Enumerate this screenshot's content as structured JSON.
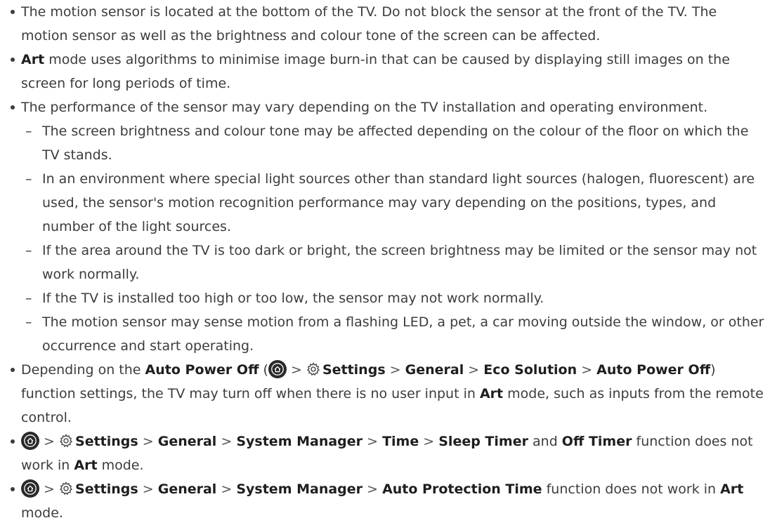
{
  "bullets": {
    "b1": "The motion sensor is located at the bottom of the TV. Do not block the sensor at the front of the TV. The motion sensor as well as the brightness and colour tone of the screen can be affected.",
    "b2": {
      "art": "Art",
      "text": " mode uses algorithms to minimise image burn-in that can be caused by displaying still images on the screen for long periods of time."
    },
    "b3": {
      "text": "The performance of the sensor may vary depending on the TV installation and operating environment.",
      "subs": [
        "The screen brightness and colour tone may be affected depending on the colour of the floor on which the TV stands.",
        "In an environment where special light sources other than standard light sources (halogen, fluorescent) are used, the sensor's motion recognition performance may vary depending on the positions, types, and number of the light sources.",
        "If the area around the TV is too dark or bright, the screen brightness may be limited or the sensor may not work normally.",
        "If the TV is installed too high or too low, the sensor may not work normally.",
        "The motion sensor may sense motion from a flashing LED, a pet, a car moving outside the window, or other occurrence and start operating."
      ]
    },
    "b4": {
      "pre": "Depending on the ",
      "apo": "Auto Power Off",
      "open": " (",
      "settings": "Settings",
      "general": "General",
      "eco": "Eco Solution",
      "apo2": "Auto Power Off",
      "mid": ") function settings, the TV may turn off when there is no user input in ",
      "art": "Art",
      "post": " mode, such as inputs from the remote control."
    },
    "b5": {
      "settings": "Settings",
      "general": "General",
      "sysmgr": "System Manager",
      "time": "Time",
      "sleep": "Sleep Timer",
      "and": " and ",
      "off": "Off Timer",
      "mid": " function does not work in ",
      "art": "Art",
      "post": " mode."
    },
    "b6": {
      "settings": "Settings",
      "general": "General",
      "sysmgr": "System Manager",
      "apt": "Auto Protection Time",
      "mid": " function does not work in ",
      "art": "Art",
      "post": " mode."
    }
  },
  "separator": ">",
  "icons": [
    "home-icon",
    "gear-icon"
  ],
  "colors": {
    "text": "#3c3c3c",
    "icon_bg": "#2a2a2a"
  }
}
